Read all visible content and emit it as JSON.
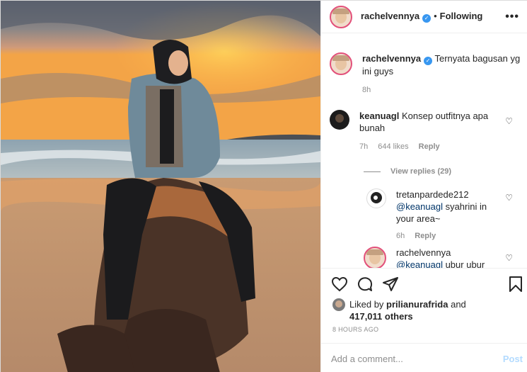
{
  "post": {
    "author": "rachelvennyа",
    "follow_status": "Following",
    "separator": "•"
  },
  "comments": [
    {
      "user": "rachelvennya",
      "text": "Ternyata bagusan yg ini guys",
      "time": "8h"
    },
    {
      "user": "keanuagl",
      "text": "Konsep outfitnya apa bunah",
      "time": "7h",
      "likes": "644 likes",
      "reply": "Reply"
    },
    {
      "user": "tretanpardede212",
      "mention": "@keanuagl",
      "text": " syahrini in your area~",
      "time": "6h",
      "reply": "Reply"
    },
    {
      "user": "rachelvennya",
      "mention": "@keanuagl",
      "text": " ubur ubur"
    }
  ],
  "view_replies": "View replies (29)",
  "likes": {
    "prefix": "Liked by",
    "user": "prilianurafrida",
    "suffix": "and",
    "count": "417,011 others"
  },
  "timestamp": "8 HOURS AGO",
  "add_comment": {
    "placeholder": "Add a comment...",
    "post_label": "Post"
  },
  "icons": [
    "heart-icon",
    "comment-icon",
    "share-icon",
    "bookmark-icon",
    "more-icon",
    "verified-icon"
  ]
}
